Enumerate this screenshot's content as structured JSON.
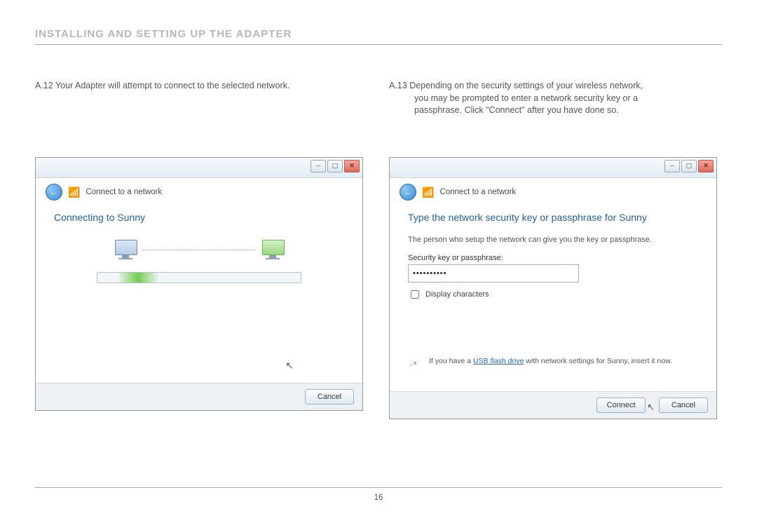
{
  "section_title": "INSTALLING AND SETTING UP THE ADAPTER",
  "page_number": "16",
  "left": {
    "step_id": "A.12",
    "step_text": "Your Adapter will attempt to connect to the selected network.",
    "dialog": {
      "header": "Connect to a network",
      "title": "Connecting to Sunny",
      "cancel": "Cancel"
    }
  },
  "right": {
    "step_id": "A.13",
    "step_line1": "Depending on the security settings of your wireless network,",
    "step_line2": "you may be prompted to enter a network security key or a",
    "step_line3": "passphrase. Click \"Connect\" after you have done so.",
    "dialog": {
      "header": "Connect to a network",
      "title": "Type the network security key or passphrase for Sunny",
      "info": "The person who setup the network can give you the key or passphrase.",
      "field_label": "Security key or passphrase:",
      "password_value": "••••••••••",
      "display_chars": "Display characters",
      "usb_pre": "If you have a ",
      "usb_link": "USB flash drive",
      "usb_post": " with network settings for Sunny, insert it now.",
      "connect": "Connect",
      "cancel": "Cancel"
    }
  }
}
